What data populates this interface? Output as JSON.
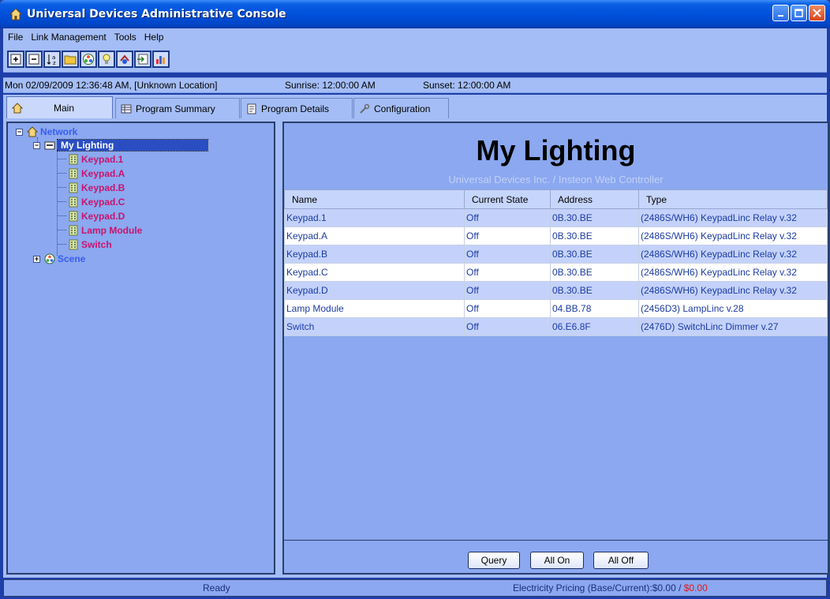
{
  "window": {
    "title": "Universal Devices Administrative Console"
  },
  "menu": [
    "File",
    "Link Management",
    "Tools",
    "Help"
  ],
  "toolbar": {
    "buttons": [
      "expand-all-icon",
      "collapse-all-icon",
      "sort-az-icon",
      "folder-icon",
      "scene-icon",
      "bulb-icon",
      "link-icon",
      "import-icon",
      "chart-icon"
    ]
  },
  "info": {
    "datetime": "Mon 02/09/2009 12:36:48 AM,  [Unknown Location]",
    "sunrise": "Sunrise: 12:00:00 AM",
    "sunset": "Sunset: 12:00:00 AM"
  },
  "tabs": [
    {
      "label": "Main",
      "active": true
    },
    {
      "label": "Program Summary",
      "active": false
    },
    {
      "label": "Program Details",
      "active": false
    },
    {
      "label": "Configuration",
      "active": false
    }
  ],
  "tree": {
    "root": "Network",
    "group": "My Lighting",
    "devices": [
      "Keypad.1",
      "Keypad.A",
      "Keypad.B",
      "Keypad.C",
      "Keypad.D",
      "Lamp Module",
      "Switch"
    ],
    "scene": "Scene"
  },
  "panel": {
    "title": "My Lighting",
    "subtitle": "Universal Devices Inc. / Insteon Web Controller"
  },
  "table": {
    "headers": [
      "Name",
      "Current State",
      "Address",
      "Type"
    ],
    "rows": [
      [
        "Keypad.1",
        "Off",
        "0B.30.BE",
        "(2486S/WH6) KeypadLinc Relay v.32"
      ],
      [
        "Keypad.A",
        "Off",
        "0B.30.BE",
        "(2486S/WH6) KeypadLinc Relay v.32"
      ],
      [
        "Keypad.B",
        "Off",
        "0B.30.BE",
        "(2486S/WH6) KeypadLinc Relay v.32"
      ],
      [
        "Keypad.C",
        "Off",
        "0B.30.BE",
        "(2486S/WH6) KeypadLinc Relay v.32"
      ],
      [
        "Keypad.D",
        "Off",
        "0B.30.BE",
        "(2486S/WH6) KeypadLinc Relay v.32"
      ],
      [
        "Lamp Module",
        "Off",
        "04.BB.78",
        "(2456D3) LampLinc v.28"
      ],
      [
        "Switch",
        "Off",
        "06.E6.8F",
        "(2476D) SwitchLinc Dimmer v.27"
      ]
    ]
  },
  "buttons": {
    "query": "Query",
    "all_on": "All On",
    "all_off": "All Off"
  },
  "status": {
    "ready": "Ready",
    "pricing_label": "Electricity Pricing (Base/Current):$0.00 / ",
    "pricing_current": "$0.00"
  },
  "colors": {
    "title_bar": "#0050dc",
    "panel_bg": "#8ba8f0",
    "device_text": "#c8146e",
    "network_text": "#3a5cf0",
    "current_price": "#e01818"
  }
}
